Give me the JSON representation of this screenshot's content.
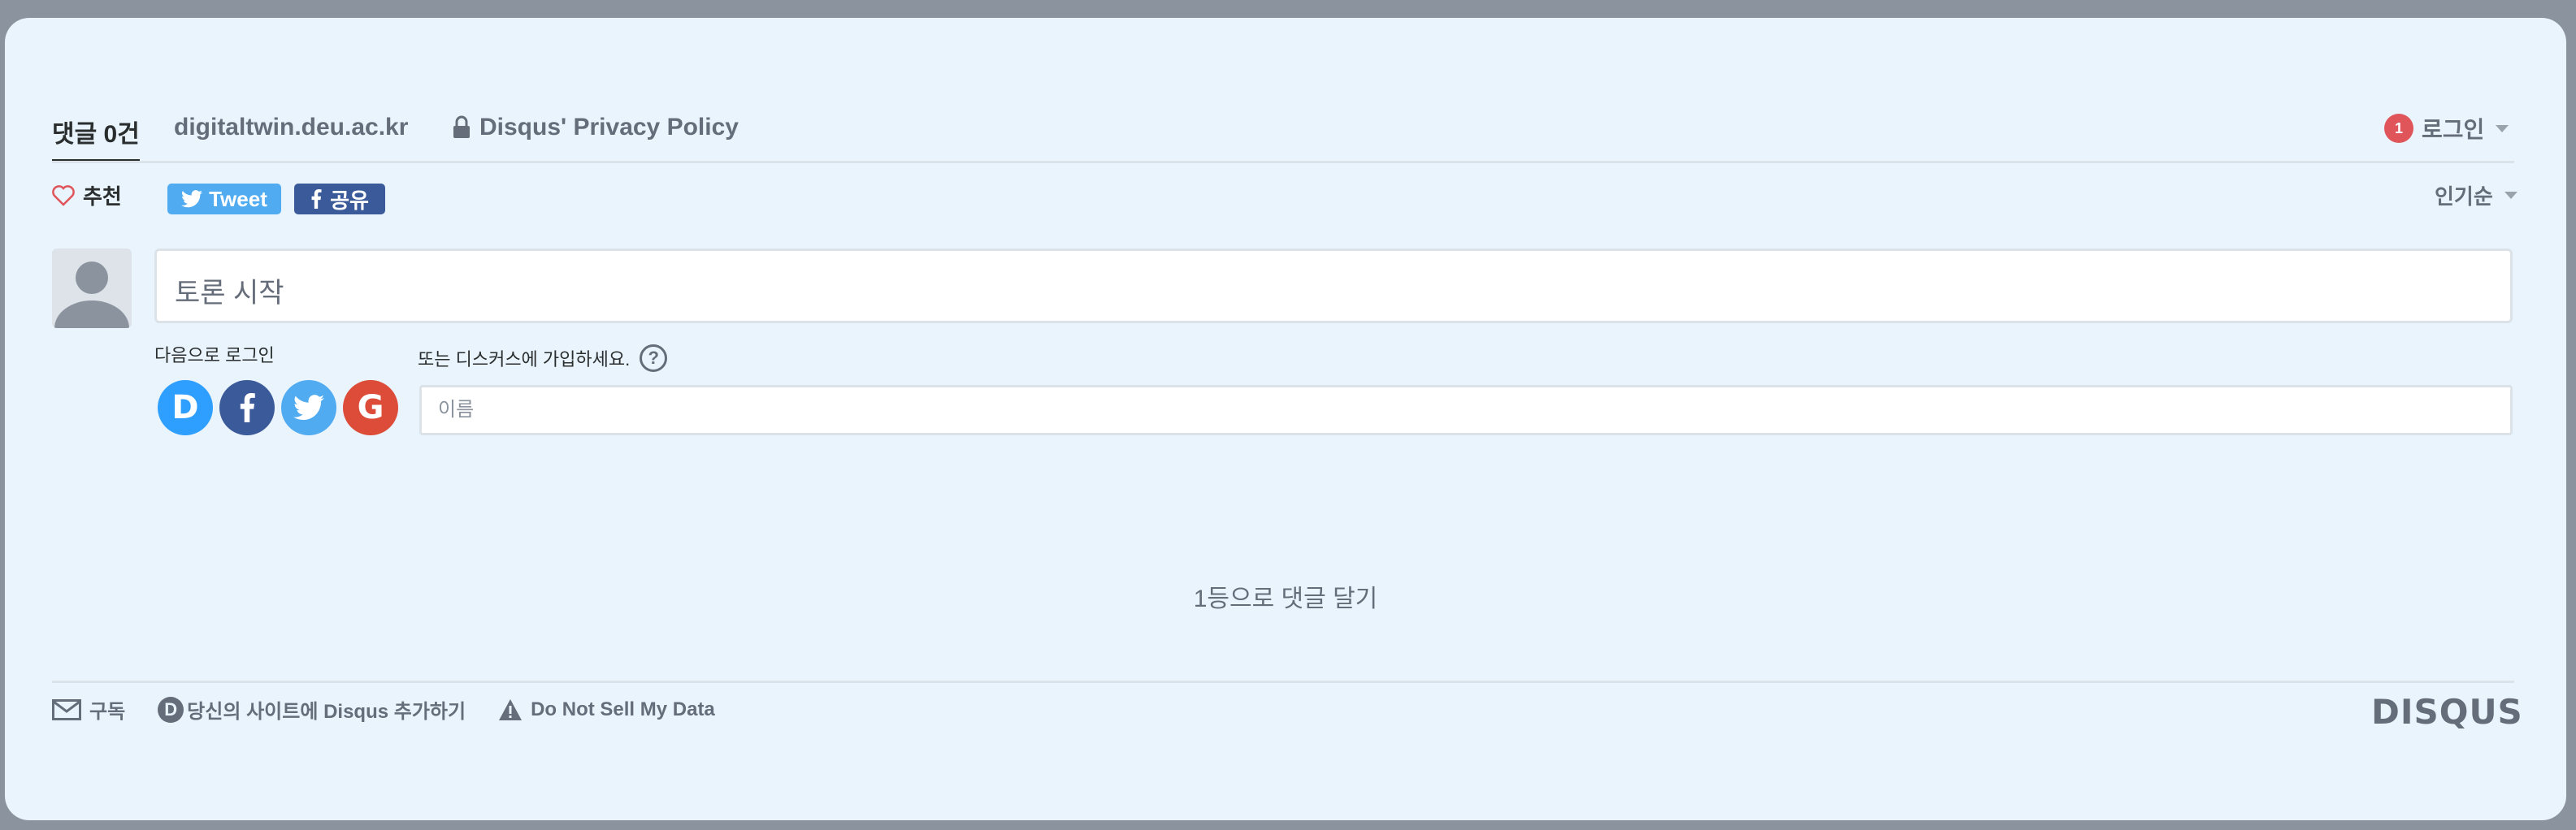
{
  "nav": {
    "comments_tab": "댓글 0건",
    "site_tab": "digitaltwin.deu.ac.kr",
    "privacy_tab": "Disqus' Privacy Policy",
    "notification_count": "1",
    "login_label": "로그인"
  },
  "actions": {
    "recommend_label": "추천",
    "tweet_label": "Tweet",
    "share_label": "공유",
    "sort_label": "인기순"
  },
  "composer": {
    "placeholder": "토론 시작",
    "login_with_label": "다음으로 로그인",
    "social_buttons": [
      "disqus",
      "facebook",
      "twitter",
      "google"
    ],
    "signup_label": "또는 디스커스에 가입하세요.",
    "help_icon_text": "?",
    "name_placeholder": "이름"
  },
  "empty_state": "1등으로 댓글 달기",
  "footer": {
    "subscribe_label": "구독",
    "add_disqus_label": "당신의 사이트에 Disqus 추가하기",
    "do_not_sell_label": "Do Not Sell My Data",
    "logo_text": "DISQUS"
  },
  "colors": {
    "background": "#e9f4fd",
    "twitter": "#50abf1",
    "facebook": "#3b5a9a",
    "google": "#dd4b39",
    "disqus": "#2e9fff",
    "notification": "#e0555a"
  }
}
